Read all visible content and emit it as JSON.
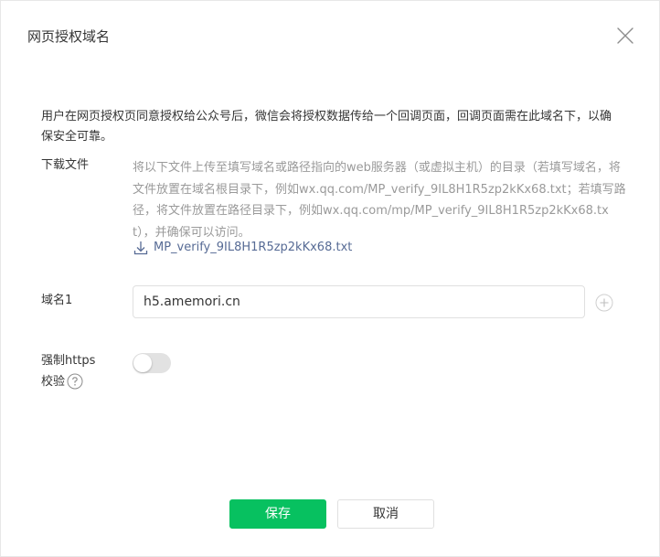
{
  "dialog": {
    "title": "网页授权域名",
    "description": "用户在网页授权页同意授权给公众号后，微信会将授权数据传给一个回调页面，回调页面需在此域名下，以确保安全可靠。"
  },
  "download": {
    "label": "下载文件",
    "instructions": "将以下文件上传至填写域名或路径指向的web服务器（或虚拟主机）的目录（若填写域名，将文件放置在域名根目录下，例如wx.qq.com/MP_verify_9IL8H1R5zp2kKx68.txt；若填写路径，将文件放置在路径目录下，例如wx.qq.com/mp/MP_verify_9IL8H1R5zp2kKx68.txt），并确保可以访问。",
    "file_link": "MP_verify_9IL8H1R5zp2kKx68.txt",
    "icon": "download-icon"
  },
  "domain": {
    "label": "域名1",
    "value": "h5.amemori.cn",
    "add_icon": "plus-circle-icon"
  },
  "https_check": {
    "label_line1": "强制https",
    "label_line2": "校验",
    "enabled": false,
    "help_icon": "question-circle-icon"
  },
  "actions": {
    "save_label": "保存",
    "cancel_label": "取消"
  },
  "colors": {
    "primary": "#07c160",
    "link": "#576b95",
    "muted_text": "#9a9a9a",
    "toggle_off": "#e2e2e2"
  }
}
